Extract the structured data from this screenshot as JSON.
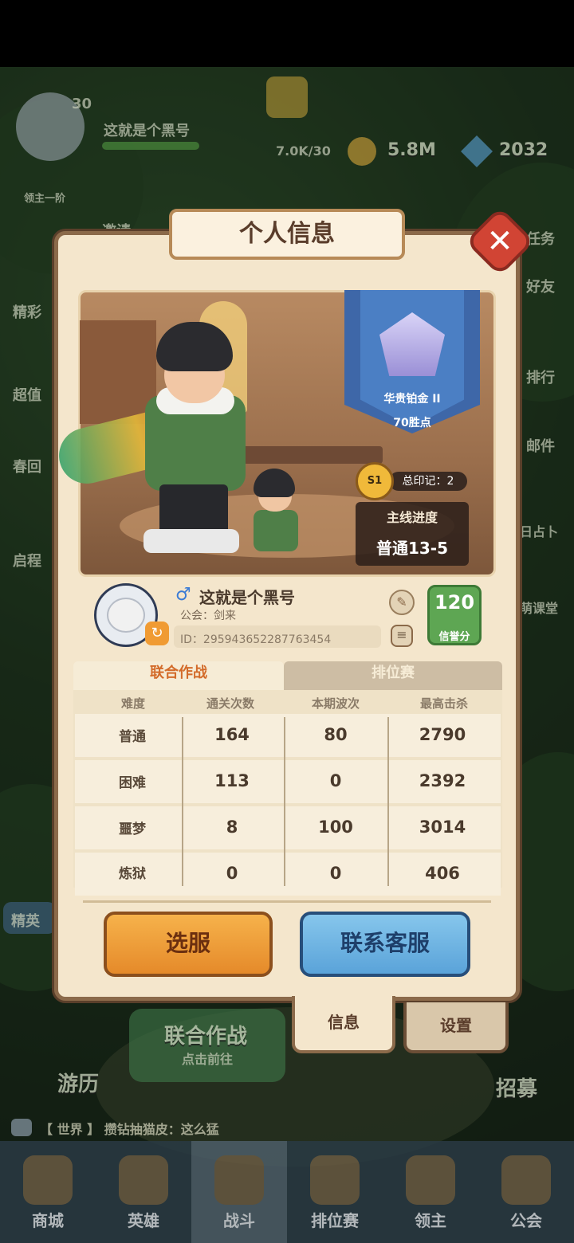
{
  "background": {
    "player_name": "这就是个黑号",
    "level": "30",
    "lord_rank": "领主一阶",
    "energy": "7.0K/30",
    "gold": "5.8M",
    "diamonds": "2032",
    "invite": "邀请",
    "side_left": [
      "精彩",
      "超值",
      "春回",
      "启程"
    ],
    "side_right": [
      "任务",
      "好友",
      "排行",
      "邮件",
      "日占卜",
      "萌课堂"
    ],
    "elite": "精英",
    "travel": "游历",
    "recruit": "招募",
    "coop_battle": "联合作战",
    "coop_go": "点击前往",
    "chat": "【 世界 】 攒钻抽猫皮：这么猛"
  },
  "bottom_nav": [
    "商城",
    "英雄",
    "战斗",
    "排位赛",
    "领主",
    "公会"
  ],
  "dialog": {
    "title": "个人信息",
    "close": "✕",
    "rank": {
      "name": "华贵铂金 II",
      "points": "70胜点"
    },
    "seal": {
      "badge": "S1",
      "label": "总印记：2"
    },
    "progress": {
      "label": "主线进度",
      "value": "普通13-5"
    },
    "profile": {
      "gender_icon": "♂",
      "name": "这就是个黑号",
      "guild": "公会：剑来",
      "id": "ID：295943652287763454",
      "credit_value": "120",
      "credit_label": "信誉分"
    },
    "tabs": {
      "coop": "联合作战",
      "rank": "排位赛"
    },
    "table": {
      "headers": [
        "难度",
        "通关次数",
        "本期波次",
        "最高击杀"
      ],
      "rows": [
        [
          "普通",
          "164",
          "80",
          "2790"
        ],
        [
          "困难",
          "113",
          "0",
          "2392"
        ],
        [
          "噩梦",
          "8",
          "100",
          "3014"
        ],
        [
          "炼狱",
          "0",
          "0",
          "406"
        ]
      ]
    },
    "buttons": {
      "select_server": "选服",
      "contact_support": "联系客服"
    },
    "bottom_tabs": {
      "info": "信息",
      "settings": "设置"
    }
  }
}
